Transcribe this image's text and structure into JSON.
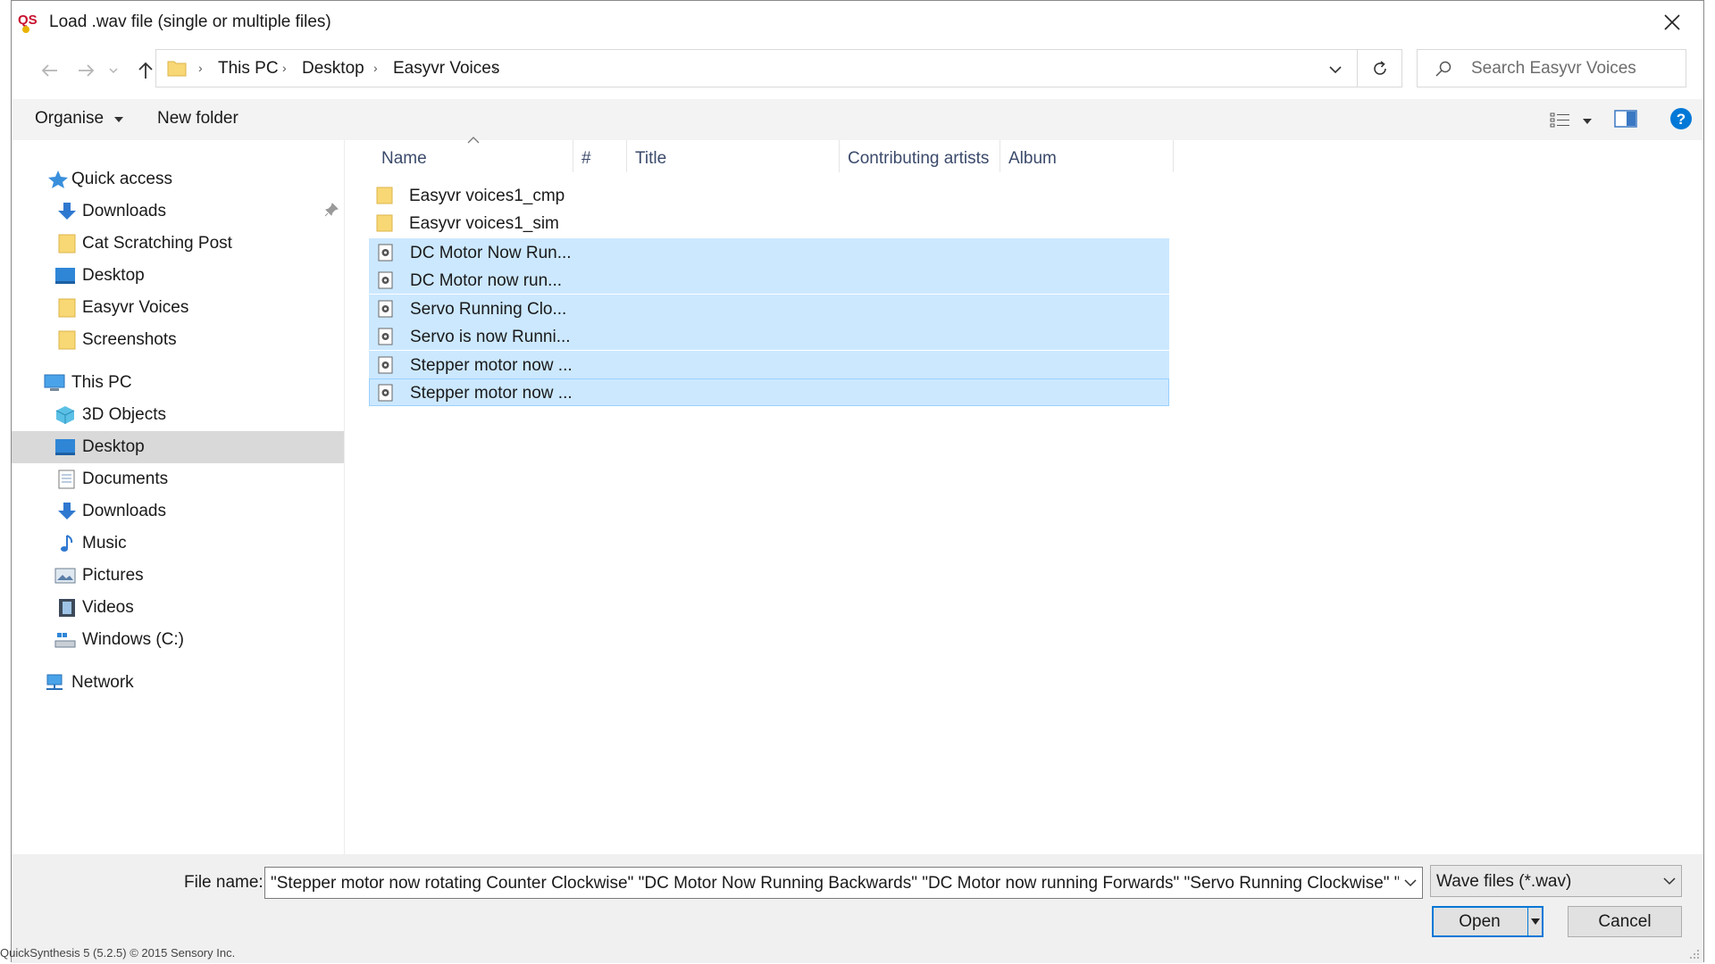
{
  "window": {
    "title": "Load .wav file (single or multiple files)"
  },
  "navbar": {
    "breadcrumbs": [
      "This PC",
      "Desktop",
      "Easyvr Voices"
    ],
    "search_placeholder": "Search Easyvr Voices"
  },
  "commands": {
    "organise": "Organise",
    "new_folder": "New folder"
  },
  "sidebar": {
    "quick_access": {
      "label": "Quick access",
      "items": [
        {
          "label": "Downloads",
          "icon": "download-arrow-icon",
          "pinned": true
        },
        {
          "label": "Cat Scratching Post",
          "icon": "folder-icon"
        },
        {
          "label": "Desktop",
          "icon": "desktop-icon"
        },
        {
          "label": "Easyvr Voices",
          "icon": "folder-icon"
        },
        {
          "label": "Screenshots",
          "icon": "folder-icon"
        }
      ]
    },
    "this_pc": {
      "label": "This PC",
      "items": [
        {
          "label": "3D Objects",
          "icon": "cube-icon"
        },
        {
          "label": "Desktop",
          "icon": "desktop-icon",
          "active": true
        },
        {
          "label": "Documents",
          "icon": "document-icon"
        },
        {
          "label": "Downloads",
          "icon": "download-arrow-icon"
        },
        {
          "label": "Music",
          "icon": "music-note-icon"
        },
        {
          "label": "Pictures",
          "icon": "pictures-icon"
        },
        {
          "label": "Videos",
          "icon": "video-icon"
        },
        {
          "label": "Windows (C:)",
          "icon": "drive-icon"
        }
      ]
    },
    "network": {
      "label": "Network"
    }
  },
  "file_list": {
    "columns": [
      "Name",
      "#",
      "Title",
      "Contributing artists",
      "Album"
    ],
    "rows": [
      {
        "name": "Easyvr voices1_cmp",
        "type": "folder",
        "selected": false
      },
      {
        "name": "Easyvr voices1_sim",
        "type": "folder",
        "selected": false
      },
      {
        "name": "DC Motor Now Run...",
        "type": "wav",
        "selected": true
      },
      {
        "name": "DC Motor now run...",
        "type": "wav",
        "selected": true
      },
      {
        "name": "Servo  Running Clo...",
        "type": "wav",
        "selected": true
      },
      {
        "name": "Servo is now Runni...",
        "type": "wav",
        "selected": true
      },
      {
        "name": "Stepper motor now ...",
        "type": "wav",
        "selected": true
      },
      {
        "name": "Stepper motor now ...",
        "type": "wav",
        "selected": true
      }
    ]
  },
  "bottom": {
    "file_name_label": "File name:",
    "file_name_value": "\"Stepper motor now rotating Counter Clockwise\" \"DC Motor Now Running Backwards\" \"DC Motor now running Forwards\" \"Servo  Running Clockwise\" \"Servo",
    "filter_value": "Wave files (*.wav)",
    "open_label": "Open",
    "cancel_label": "Cancel"
  },
  "status_bar": {
    "text": "QuickSynthesis 5 (5.2.5) © 2015 Sensory Inc."
  },
  "colors": {
    "selection": "#cce8ff",
    "selection_border": "#99d1ff",
    "accent": "#0078d7",
    "help": "#0078d7"
  }
}
